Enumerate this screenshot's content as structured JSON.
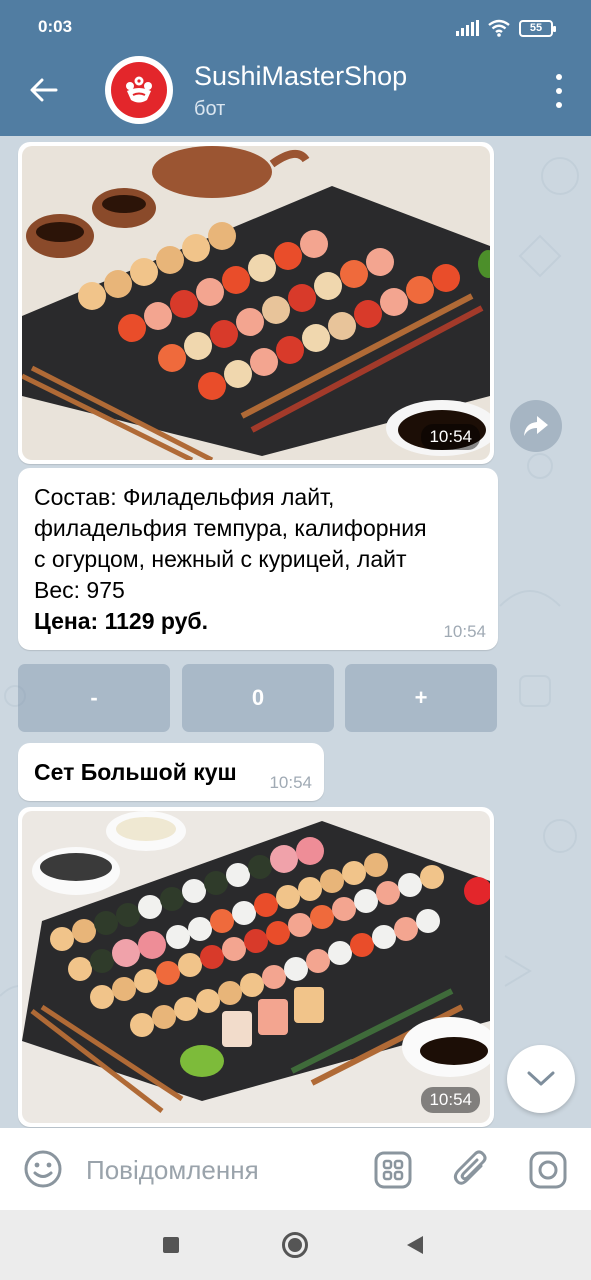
{
  "status_bar": {
    "time": "0:03",
    "battery": "55"
  },
  "header": {
    "title": "SushiMasterShop",
    "subtitle": "бот"
  },
  "messages": {
    "photo1_time": "10:54",
    "product_text": {
      "line1": "Состав: Филадельфия лайт,",
      "line2": "филадельфия темпура, калифорния",
      "line3": "с огурцом, нежный с курицей, лайт",
      "weight": "Вес: 975",
      "price": "Цена: 1129 руб.",
      "time": "10:54"
    },
    "keyboard": {
      "minus": "-",
      "count": "0",
      "plus": "+"
    },
    "set_name": {
      "text": "Сет Большой куш",
      "time": "10:54"
    },
    "photo2_time": "10:54"
  },
  "input": {
    "placeholder": "Повідомлення"
  },
  "icons": {
    "back": "arrow-left-icon",
    "menu": "more-vertical-icon",
    "share": "share-icon",
    "scroll": "chevron-down-icon",
    "emoji": "emoji-icon",
    "bot_commands": "grid-icon",
    "attach": "paperclip-icon",
    "camera": "camera-icon"
  },
  "colors": {
    "header": "#517da2",
    "chat_bg": "#ccd7e0",
    "brand_red": "#e3262b"
  }
}
